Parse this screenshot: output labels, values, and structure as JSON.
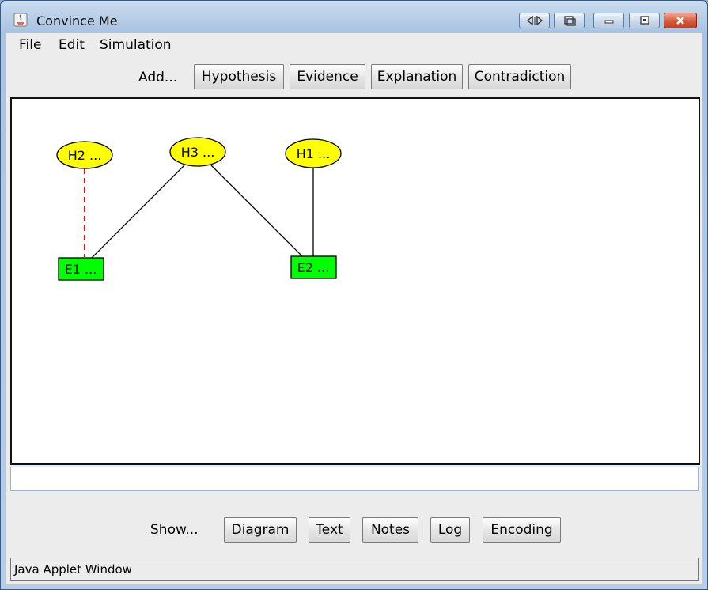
{
  "window": {
    "title": "Convince Me",
    "controls": [
      "resize-arrows-icon",
      "copy-icon",
      "minimize-icon",
      "maximize-icon",
      "close-icon"
    ]
  },
  "menu": {
    "file": "File",
    "edit": "Edit",
    "simulation": "Simulation"
  },
  "add_bar": {
    "label": "Add...",
    "hypothesis": "Hypothesis",
    "evidence": "Evidence",
    "explanation": "Explanation",
    "contradiction": "Contradiction"
  },
  "diagram": {
    "nodes": {
      "h2": "H2 ...",
      "h3": "H3 ...",
      "h1": "H1 ...",
      "e1": "E1 ...",
      "e2": "E2 ..."
    },
    "colors": {
      "hypothesis_fill": "#ffff00",
      "evidence_fill": "#00ff00",
      "explanation_line": "#000000",
      "contradiction_line": "#ff0000"
    }
  },
  "input": {
    "value": ""
  },
  "show_bar": {
    "label": "Show...",
    "diagram": "Diagram",
    "text": "Text",
    "notes": "Notes",
    "log": "Log",
    "encoding": "Encoding"
  },
  "status": "Java Applet Window"
}
